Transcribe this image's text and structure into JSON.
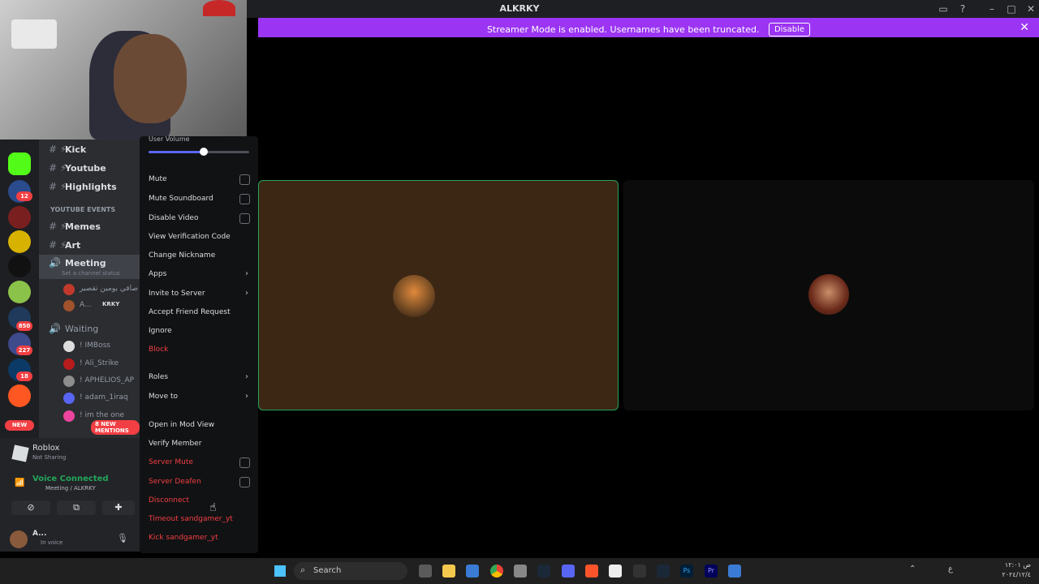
{
  "window": {
    "title": "ALKRKY"
  },
  "banner": {
    "text": "Streamer Mode is enabled. Usernames have been truncated.",
    "disable_label": "Disable"
  },
  "channels": {
    "kick": "Kick",
    "youtube": "Youtube",
    "highlights": "Highlights",
    "category": "YOUTUBE EVENTS",
    "memes": "Memes",
    "art": "Art",
    "meeting": "Meeting",
    "meeting_status": "Set a channel status",
    "waiting": "Waiting",
    "meeting_members": [
      "صافي يومين تقصير !",
      "A..."
    ],
    "krky_tag": "KRKY",
    "waiting_members": [
      "! IMBoss",
      "! Ali_Strike",
      "! APHELIOS_AP",
      "! adam_1iraq",
      "! im the one"
    ],
    "mentions_badge": "8 NEW MENTIONS"
  },
  "rail": {
    "badges": [
      "12",
      "850",
      "227",
      "18"
    ],
    "new_label": "NEW"
  },
  "activity": {
    "name": "Roblox",
    "status": "Not Sharing"
  },
  "voice": {
    "title": "Voice Connected",
    "channel": "Meeting / ALKRKY"
  },
  "user": {
    "name": "A...",
    "status": "In voice"
  },
  "menu": {
    "user_volume": "User Volume",
    "volume_level": 0.55,
    "items": {
      "mute": "Mute",
      "mute_soundboard": "Mute Soundboard",
      "disable_video": "Disable Video",
      "verification": "View Verification Code",
      "nickname": "Change Nickname",
      "apps": "Apps",
      "invite": "Invite to Server",
      "accept_friend": "Accept Friend Request",
      "ignore": "Ignore",
      "block": "Block",
      "roles": "Roles",
      "move_to": "Move to",
      "mod_view": "Open in Mod View",
      "verify": "Verify Member",
      "server_mute": "Server Mute",
      "server_deafen": "Server Deafen",
      "disconnect": "Disconnect",
      "timeout": "Timeout sandgamer_yt",
      "kick": "Kick sandgamer_yt"
    }
  },
  "taskbar": {
    "search_label": "Search",
    "time": "ص ١٢:٠١",
    "date": "٢٠٢٤/١٢/٤",
    "lang": "ع"
  },
  "colors": {
    "accent": "#9b35f3",
    "speaking": "#23a55a",
    "danger": "#f23f43"
  }
}
